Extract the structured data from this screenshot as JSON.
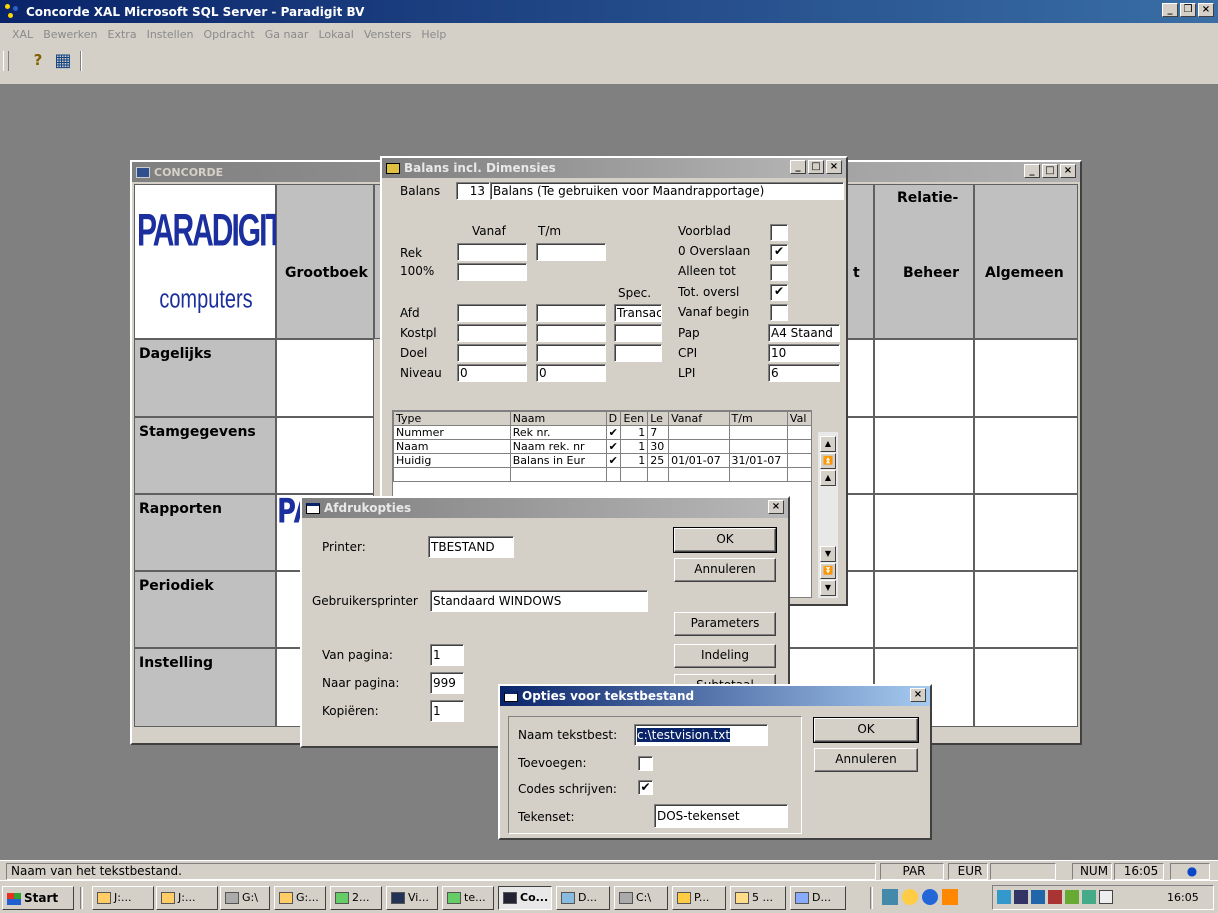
{
  "app": {
    "title": "Concorde XAL Microsoft SQL Server - Paradigit BV",
    "min": "_",
    "max": "❒",
    "close": "×"
  },
  "menu": [
    "XAL",
    "Bewerken",
    "Extra",
    "Instellen",
    "Opdracht",
    "Ga naar",
    "Lokaal",
    "Vensters",
    "Help"
  ],
  "toolbar": {
    "help_icon": "?",
    "grid_icon": "▦"
  },
  "concorde": {
    "title": "CONCORDE",
    "logo_top": "PARADIGIT",
    "logo_bottom": "computers",
    "col_headers": [
      "Grootboek",
      "",
      "",
      "t",
      "Relatie-",
      "Beheer",
      "Algemeen"
    ],
    "relatie": "Relatie-",
    "beheer": "Beheer",
    "algemeen": "Algemeen",
    "grootboek": "Grootboek",
    "t_partial": "t",
    "rows": [
      "Dagelijks",
      "Stamgegevens",
      "Rapporten",
      "Periodiek",
      "Instelling"
    ],
    "pa_partial": "PA",
    "c_partial": "("
  },
  "balans": {
    "title": "Balans incl. Dimensies",
    "balans_label": "Balans",
    "balans_num": "13",
    "balans_desc": "Balans (Te gebruiken voor Maandrapportage)",
    "vanaf": "Vanaf",
    "tm": "T/m",
    "rek": "Rek",
    "pct": "100%",
    "spec": "Spec.",
    "afd": "Afd",
    "kostpl": "Kostpl",
    "doel": "Doel",
    "niveau": "Niveau",
    "niveau_from": "0",
    "niveau_to": "0",
    "spec_value": "Transac",
    "voorblad": "Voorblad",
    "overslaan": "0 Overslaan",
    "alleen_tot": "Alleen tot",
    "tot_oversl": "Tot. oversl",
    "vanaf_begin": "Vanaf begin",
    "pap": "Pap",
    "pap_value": "A4 Staand",
    "cpi": "CPI",
    "cpi_value": "10",
    "lpi": "LPI",
    "lpi_value": "6",
    "check": "✔",
    "grid_headers": [
      "Type",
      "Naam",
      "D",
      "Een",
      "Le",
      "Vanaf",
      "T/m",
      "Val"
    ],
    "grid_rows": [
      [
        "Nummer",
        "Rek nr.",
        "✔",
        "1",
        "7",
        "",
        "",
        ""
      ],
      [
        "Naam",
        "Naam rek. nr",
        "✔",
        "1",
        "30",
        "",
        "",
        ""
      ],
      [
        "Huidig",
        "Balans in Eur",
        "✔",
        "1",
        "25",
        "01/01-07",
        "31/01-07",
        ""
      ]
    ]
  },
  "afdruk": {
    "title": "Afdrukopties",
    "printer_label": "Printer:",
    "printer_value": "TBESTAND",
    "gebr_label": "Gebruikersprinter",
    "gebr_value": "Standaard WINDOWS",
    "van_label": "Van pagina:",
    "van_value": "1",
    "naar_label": "Naar pagina:",
    "naar_value": "999",
    "kop_label": "Kopiëren:",
    "kop_value": "1",
    "ok": "OK",
    "annuleren": "Annuleren",
    "parameters": "Parameters",
    "indeling": "Indeling",
    "subtotaal": "Subtotaal"
  },
  "opties": {
    "title": "Opties voor tekstbestand",
    "naam_label": "Naam tekstbest:",
    "naam_value": "c:\\testvision.txt",
    "toev_label": "Toevoegen:",
    "codes_label": "Codes schrijven:",
    "codes_check": "✔",
    "tekenset_label": "Tekenset:",
    "tekenset_value": "DOS-tekenset",
    "ok": "OK",
    "annuleren": "Annuleren"
  },
  "status": {
    "message": "Naam van het tekstbestand.",
    "par": "PAR",
    "eur": "EUR",
    "num": "NUM",
    "time": "16:05"
  },
  "taskbar": {
    "start": "Start",
    "items": [
      "J:...",
      "J:...",
      "G:\\",
      "G:...",
      "2...",
      "Vi...",
      "te...",
      "Co...",
      "D...",
      "C:\\",
      "P...",
      "5 ...",
      "D..."
    ],
    "clock": "16:05"
  }
}
